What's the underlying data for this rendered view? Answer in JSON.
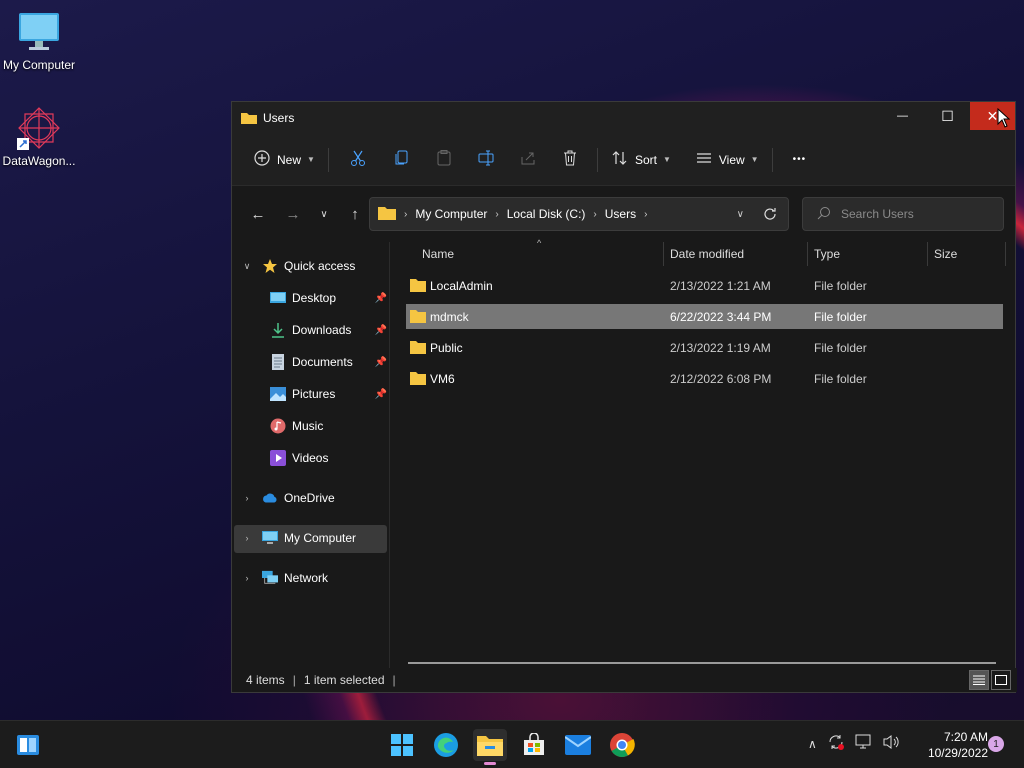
{
  "desktop": {
    "icons": [
      {
        "label": "My Computer",
        "icon": "monitor-icon"
      },
      {
        "label": "DataWagon...",
        "icon": "datawagon-shortcut-icon"
      }
    ]
  },
  "window": {
    "title": "Users",
    "controls": {
      "minimize": "—",
      "maximize": "☐",
      "close": "✕"
    }
  },
  "toolbar": {
    "new_label": "New",
    "sort_label": "Sort",
    "view_label": "View",
    "more_label": "•••"
  },
  "address": {
    "crumbs": [
      "My Computer",
      "Local Disk (C:)",
      "Users"
    ]
  },
  "search": {
    "placeholder": "Search Users"
  },
  "sidebar": {
    "quick_access": "Quick access",
    "items": [
      {
        "label": "Desktop",
        "pinned": true
      },
      {
        "label": "Downloads",
        "pinned": true
      },
      {
        "label": "Documents",
        "pinned": true
      },
      {
        "label": "Pictures",
        "pinned": true
      },
      {
        "label": "Music",
        "pinned": false
      },
      {
        "label": "Videos",
        "pinned": false
      }
    ],
    "onedrive": "OneDrive",
    "my_computer": "My Computer",
    "network": "Network"
  },
  "columns": {
    "name": "Name",
    "date": "Date modified",
    "type": "Type",
    "size": "Size"
  },
  "files": [
    {
      "name": "LocalAdmin",
      "date": "2/13/2022 1:21 AM",
      "type": "File folder",
      "selected": false
    },
    {
      "name": "mdmck",
      "date": "6/22/2022 3:44 PM",
      "type": "File folder",
      "selected": true
    },
    {
      "name": "Public",
      "date": "2/13/2022 1:19 AM",
      "type": "File folder",
      "selected": false
    },
    {
      "name": "VM6",
      "date": "2/12/2022 6:08 PM",
      "type": "File folder",
      "selected": false
    }
  ],
  "status": {
    "items": "4 items",
    "selected": "1 item selected"
  },
  "taskbar": {
    "clock_time": "7:20 AM",
    "clock_date": "10/29/2022",
    "notification_count": "1"
  },
  "colors": {
    "accent": "#c42b1c",
    "folder": "#f5c542",
    "selection": "#777777"
  }
}
